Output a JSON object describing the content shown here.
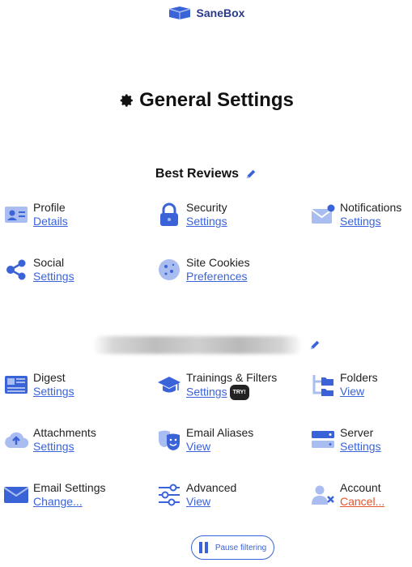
{
  "brand": {
    "name": "SaneBox"
  },
  "page": {
    "title": "General Settings"
  },
  "sections": [
    {
      "title": "Best Reviews",
      "items": [
        {
          "label": "Profile",
          "link": "Details",
          "icon": "id-card-icon"
        },
        {
          "label": "Security",
          "link": "Settings",
          "icon": "lock-icon"
        },
        {
          "label": "Notifications",
          "link": "Settings",
          "icon": "envelope-notification-icon"
        },
        {
          "label": "Social",
          "link": "Settings",
          "icon": "share-icon"
        },
        {
          "label": "Site Cookies",
          "link": "Preferences",
          "icon": "cookie-icon"
        }
      ]
    },
    {
      "title": "",
      "items": [
        {
          "label": "Digest",
          "link": "Settings",
          "icon": "digest-icon"
        },
        {
          "label": "Trainings & Filters",
          "link": "Settings",
          "badge": "TRY!",
          "icon": "graduation-cap-icon"
        },
        {
          "label": "Folders",
          "link": "View",
          "icon": "folders-icon"
        },
        {
          "label": "Attachments",
          "link": "Settings",
          "icon": "cloud-upload-icon"
        },
        {
          "label": "Email Aliases",
          "link": "View",
          "icon": "masks-icon"
        },
        {
          "label": "Server",
          "link": "Settings",
          "icon": "server-icon"
        },
        {
          "label": "Email Settings",
          "link": "Change...",
          "icon": "envelope-icon"
        },
        {
          "label": "Advanced",
          "link": "View",
          "icon": "sliders-icon"
        },
        {
          "label": "Account",
          "link": "Cancel...",
          "icon": "user-remove-icon"
        }
      ]
    }
  ],
  "footer": {
    "pause_label": "Pause filtering"
  },
  "colors": {
    "accent": "#3a63d8",
    "icon_light": "#a9bdf0",
    "danger": "#e0552c",
    "brand": "#2a3a8c"
  }
}
